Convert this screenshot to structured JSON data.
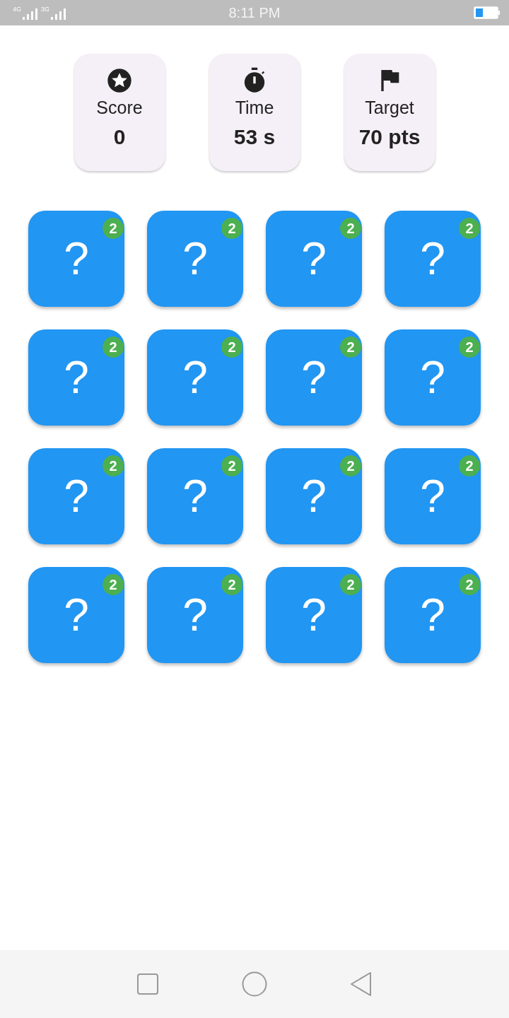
{
  "status_bar": {
    "network_1": "4G",
    "network_2": "3G",
    "time": "8:11 PM"
  },
  "stats": [
    {
      "kind": "score",
      "label": "Score",
      "value": "0"
    },
    {
      "kind": "time",
      "label": "Time",
      "value": "53 s"
    },
    {
      "kind": "target",
      "label": "Target",
      "value": "70 pts"
    }
  ],
  "tiles": [
    {
      "label": "?",
      "badge": "2"
    },
    {
      "label": "?",
      "badge": "2"
    },
    {
      "label": "?",
      "badge": "2"
    },
    {
      "label": "?",
      "badge": "2"
    },
    {
      "label": "?",
      "badge": "2"
    },
    {
      "label": "?",
      "badge": "2"
    },
    {
      "label": "?",
      "badge": "2"
    },
    {
      "label": "?",
      "badge": "2"
    },
    {
      "label": "?",
      "badge": "2"
    },
    {
      "label": "?",
      "badge": "2"
    },
    {
      "label": "?",
      "badge": "2"
    },
    {
      "label": "?",
      "badge": "2"
    },
    {
      "label": "?",
      "badge": "2"
    },
    {
      "label": "?",
      "badge": "2"
    },
    {
      "label": "?",
      "badge": "2"
    },
    {
      "label": "?",
      "badge": "2"
    }
  ]
}
